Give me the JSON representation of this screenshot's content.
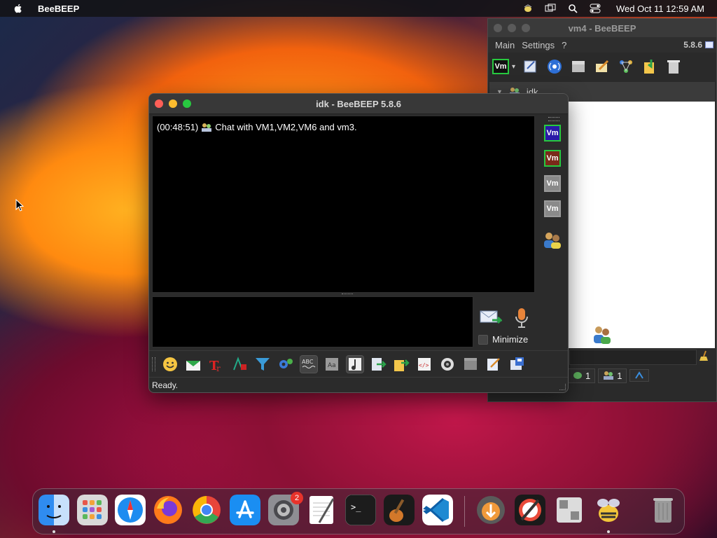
{
  "menubar": {
    "app_name": "BeeBEEP",
    "clock": "Wed Oct 11  12:59 AM",
    "icons": [
      "apple-icon",
      "beebeep-tray-icon",
      "screen-mirroring-icon",
      "spotlight-search-icon",
      "control-center-icon"
    ]
  },
  "bg_window": {
    "title": "vm4 - BeeBEEP",
    "menu": [
      "Main",
      "Settings",
      "?"
    ],
    "version": "5.8.6",
    "avatar_label": "Vm",
    "tree_header": "idk",
    "status_tabs": [
      {
        "icon": "chat-icon",
        "count": "1"
      },
      {
        "icon": "users-icon",
        "count": "1"
      }
    ]
  },
  "main_window": {
    "title": "idk - BeeBEEP 5.8.6",
    "chat": {
      "timestamp": "(00:48:51)",
      "message": "Chat with VM1,VM2,VM6 and vm3."
    },
    "members": [
      {
        "label": "Vm",
        "color": "#2a1aa8"
      },
      {
        "label": "Vm",
        "color": "#7a2a1a"
      },
      {
        "label": "Vm",
        "color": "#8a8a8a"
      },
      {
        "label": "Vm",
        "color": "#8a8a8a"
      }
    ],
    "minimize_label": "Minimize",
    "status": "Ready."
  },
  "dock": {
    "apps": [
      "Finder",
      "Launchpad",
      "Safari",
      "Firefox",
      "Chrome",
      "App Store",
      "System Settings",
      "TextEdit",
      "Terminal",
      "GarageBand",
      "Visual Studio Code",
      "Downloads",
      "Instruments",
      "Boot Camp",
      "BeeBEEP",
      "Trash"
    ],
    "settings_badge": "2"
  },
  "colors": {
    "traffic_red": "#ff5f57",
    "traffic_yellow": "#febc2e",
    "traffic_green": "#28c840",
    "accent_green": "#27c93f"
  }
}
